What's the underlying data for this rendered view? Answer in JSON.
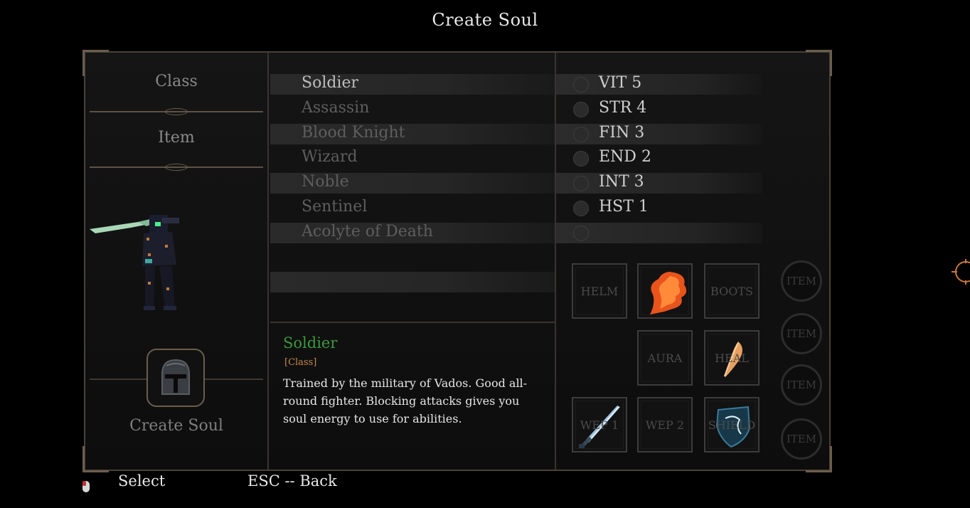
{
  "page": {
    "title": "Create Soul"
  },
  "tabs": {
    "class_label": "Class",
    "item_label": "Item"
  },
  "create": {
    "label": "Create Soul"
  },
  "classes": [
    {
      "label": "Soldier",
      "selected": true
    },
    {
      "label": "Assassin",
      "selected": false
    },
    {
      "label": "Blood Knight",
      "selected": false
    },
    {
      "label": "Wizard",
      "selected": false
    },
    {
      "label": "Noble",
      "selected": false
    },
    {
      "label": "Sentinel",
      "selected": false
    },
    {
      "label": "Acolyte of Death",
      "selected": false
    }
  ],
  "description": {
    "title": "Soldier",
    "tag": "[Class]",
    "text": "Trained by the military of Vados. Good all-round fighter. Blocking attacks gives you soul energy to use for abilities."
  },
  "stats": [
    {
      "label": "VIT 5",
      "icon": "heart-icon"
    },
    {
      "label": "STR 4",
      "icon": "fist-icon"
    },
    {
      "label": "FIN 3",
      "icon": "finesse-icon"
    },
    {
      "label": "END 2",
      "icon": "leg-icon"
    },
    {
      "label": "INT 3",
      "icon": "brain-icon"
    },
    {
      "label": "HST 1",
      "icon": "clock-icon"
    },
    {
      "label": "",
      "icon": "skull-icon"
    }
  ],
  "equipment": {
    "helm": "HELM",
    "cape": "",
    "boots": "BOOTS",
    "aura": "AURA",
    "heal": "HEAL",
    "wep1": "WEP 1",
    "wep2": "WEP 2",
    "shield": "SHIELD"
  },
  "items": [
    "ITEM",
    "ITEM",
    "ITEM",
    "ITEM"
  ],
  "footer": {
    "select": "Select",
    "back": "ESC -- Back"
  },
  "colors": {
    "background": "#000000",
    "frame": "#4a4238",
    "description_title": "#3a9a3a",
    "description_tag": "#c88a4a",
    "edge_icon": "#c8783a"
  }
}
